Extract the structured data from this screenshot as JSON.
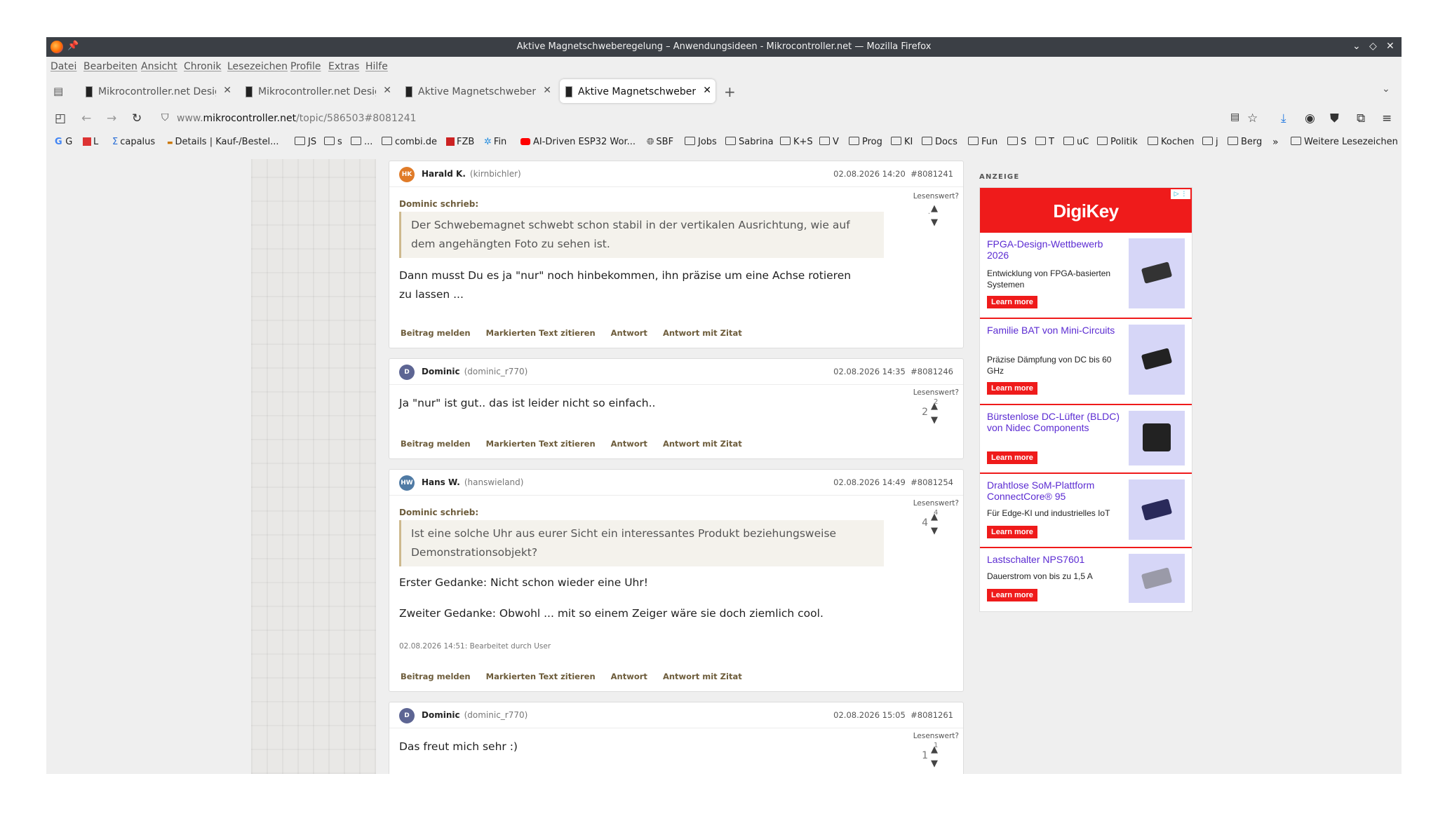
{
  "window": {
    "title": "Aktive Magnetschweberegelung – Anwendungsideen - Mikrocontroller.net — Mozilla Firefox"
  },
  "menu": [
    "Datei",
    "Bearbeiten",
    "Ansicht",
    "Chronik",
    "Lesezeichen",
    "Profile",
    "Extras",
    "Hilfe"
  ],
  "tabs": [
    {
      "label": "Mikrocontroller.net Design",
      "active": false
    },
    {
      "label": "Mikrocontroller.net Design",
      "active": false
    },
    {
      "label": "Aktive Magnetschweberegelung",
      "active": false
    },
    {
      "label": "Aktive Magnetschweberegelung",
      "active": true
    }
  ],
  "address": {
    "prefix": "www.",
    "domain": "mikrocontroller.net",
    "path": "/topic/586503#8081241"
  },
  "bookmarks": [
    "G",
    "L",
    "capalus",
    "Details | Kauf-/Bestel...",
    "JS",
    "s",
    "...",
    "combi.de",
    "FZB",
    "Fin",
    "AI-Driven ESP32 Wor...",
    "SBF",
    "Jobs",
    "Sabrina",
    "K+S",
    "V",
    "Prog",
    "KI",
    "Docs",
    "Fun",
    "S",
    "T",
    "uC",
    "Politik",
    "Kochen",
    "j",
    "Berg",
    "Weitere Lesezeichen"
  ],
  "posts": [
    {
      "initials": "HK",
      "avatar_color": "#e07b28",
      "author": "Harald K.",
      "handle": "(kirnbichler)",
      "date": "02.08.2026 14:20",
      "id": "#8081241",
      "quote_author": "Dominic schrieb:",
      "quote_text": "Der Schwebemagnet schwebt schon stabil in der vertikalen Ausrichtung, wie auf dem angehängten Foto zu sehen ist.",
      "body": [
        "Dann musst Du es ja \"nur\" noch hinbekommen, ihn präzise um eine Achse rotieren zu lassen ..."
      ],
      "vote_label": "Lesenswert?",
      "score": "",
      "up_count": ""
    },
    {
      "initials": "D",
      "avatar_color": "#5d6593",
      "author": "Dominic",
      "handle": "(dominic_r770)",
      "date": "02.08.2026 14:35",
      "id": "#8081246",
      "body": [
        "Ja \"nur\" ist gut.. das ist leider nicht so einfach.."
      ],
      "vote_label": "Lesenswert?",
      "score": "2",
      "up_count": "2"
    },
    {
      "initials": "HW",
      "avatar_color": "#4f7aa4",
      "author": "Hans W.",
      "handle": "(hanswieland)",
      "date": "02.08.2026 14:49",
      "id": "#8081254",
      "quote_author": "Dominic schrieb:",
      "quote_text": "Ist eine solche Uhr aus eurer Sicht ein interessantes Produkt beziehungsweise Demonstrationsobjekt?",
      "body": [
        "Erster Gedanke: Nicht schon wieder eine Uhr!",
        "Zweiter Gedanke: Obwohl ... mit so einem Zeiger wäre sie doch ziemlich cool."
      ],
      "edit_note": "02.08.2026 14:51: Bearbeitet durch User",
      "vote_label": "Lesenswert?",
      "score": "4",
      "up_count": "4"
    },
    {
      "initials": "D",
      "avatar_color": "#5d6593",
      "author": "Dominic",
      "handle": "(dominic_r770)",
      "date": "02.08.2026 15:05",
      "id": "#8081261",
      "body": [
        "Das freut mich sehr :)"
      ],
      "vote_label": "Lesenswert?",
      "score": "1",
      "up_count": "1"
    }
  ],
  "post_actions": [
    "Beitrag melden",
    "Markierten Text zitieren",
    "Antwort",
    "Antwort mit Zitat"
  ],
  "ad": {
    "label": "ANZEIGE",
    "brand": "DigiKey",
    "accent": "#ef1b1b",
    "items": [
      {
        "title": "FPGA-Design-Wettbewerb 2026",
        "desc": "Entwicklung von FPGA-basierten Systemen",
        "cta": "Learn more"
      },
      {
        "title": "Familie BAT von Mini-Circuits",
        "desc": "Präzise Dämpfung von DC bis 60 GHz",
        "cta": "Learn more"
      },
      {
        "title": "Bürstenlose DC-Lüfter (BLDC) von Nidec Components",
        "desc": "",
        "cta": "Learn more"
      },
      {
        "title": "Drahtlose SoM-Plattform ConnectCore® 95",
        "desc": "Für Edge-KI und industrielles IoT",
        "cta": "Learn more"
      },
      {
        "title": "Lastschalter NPS7601",
        "desc": "Dauerstrom von bis zu 1,5 A",
        "cta": "Learn more"
      }
    ]
  }
}
